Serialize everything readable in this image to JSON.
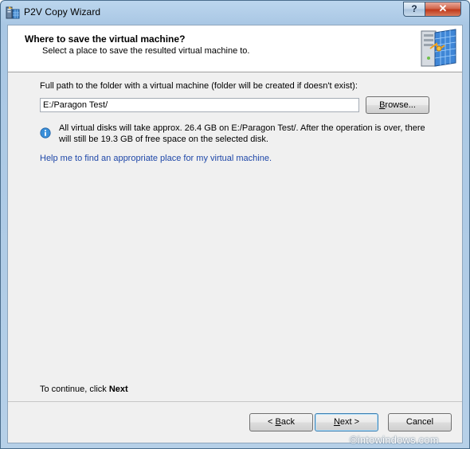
{
  "window": {
    "title": "P2V Copy Wizard",
    "help_glyph": "?",
    "close_glyph": "✕"
  },
  "header": {
    "title": "Where to save the virtual machine?",
    "subtitle": "Select a place to save the resulted virtual machine to."
  },
  "form": {
    "path_label": "Full path to the folder with a virtual machine (folder will be created if doesn't exist):",
    "path_value": "E:/Paragon Test/",
    "browse_label_pre": "",
    "browse_label_underlined": "B",
    "browse_label_post": "rowse...",
    "info_text": "All virtual disks will take approx. 26.4 GB on E:/Paragon Test/. After the operation is over, there will still be 19.3 GB of free space on the selected disk.",
    "help_link": "Help me to find an appropriate place for my virtual machine."
  },
  "footer": {
    "continue_prefix": "To continue, click ",
    "continue_bold": "Next",
    "back_pre": "< ",
    "back_underlined": "B",
    "back_post": "ack",
    "next_underlined": "N",
    "next_post": "ext >",
    "cancel_label": "Cancel"
  },
  "watermark": "©intowindows.com",
  "icons": {
    "app": "p2v-wizard-icon",
    "header": "server-with-globe-icon",
    "info": "info-icon"
  },
  "colors": {
    "link": "#1e47a8",
    "window_frame": "#a9c7e4",
    "close_button": "#c0391b"
  }
}
